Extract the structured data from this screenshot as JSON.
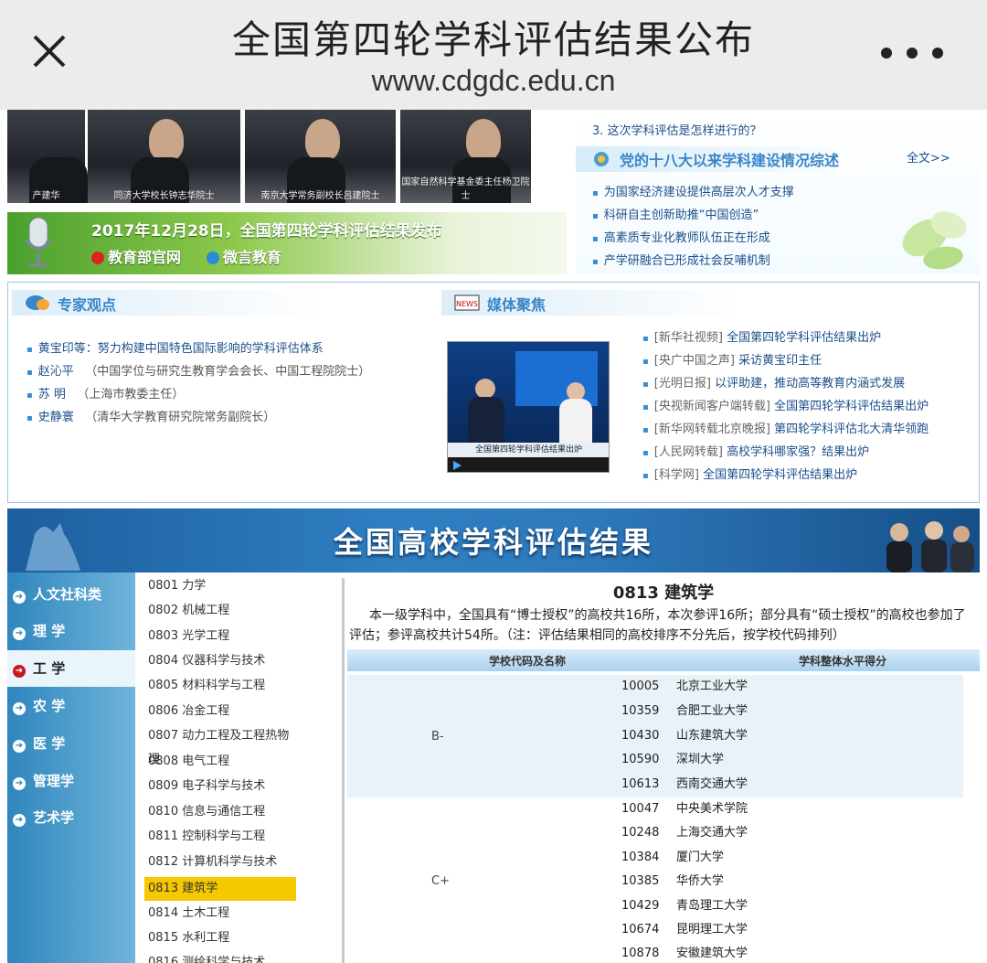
{
  "browser": {
    "title": "全国第四轮学科评估结果公布",
    "url": "www.cdgdc.edu.cn"
  },
  "banner": {
    "captions": [
      "产建华",
      "同济大学校长钟志华院士",
      "南京大学常务副校长吕建院士",
      "国家自然科学基金委主任杨卫院士"
    ],
    "announcement": "2017年12月28日，全国第四轮学科评估结果发布",
    "link1": "教育部官网",
    "link2": "微言教育"
  },
  "right_news": {
    "question3": "3. 这次学科评估是怎样进行的？",
    "section_title": "党的十八大以来学科建设情况综述",
    "full_text_link": "全文>>",
    "items": [
      "为国家经济建设提供高层次人才支撑",
      "科研自主创新助推“中国创造”",
      "高素质专业化教师队伍正在形成",
      "产学研融合已形成社会反哺机制"
    ]
  },
  "experts": {
    "title": "专家观点",
    "items": [
      {
        "name": "黄宝印等：努力构建中国特色国际影响的学科评估体系",
        "note": ""
      },
      {
        "name": "赵沁平",
        "note": "（中国学位与研究生教育学会会长、中国工程院院士）"
      },
      {
        "name": "苏  明",
        "note": "（上海市教委主任）"
      },
      {
        "name": "史静寰",
        "note": "（清华大学教育研究院常务副院长）"
      }
    ]
  },
  "media": {
    "title": "媒体聚焦",
    "icon_text": "NEWS",
    "video_caption": "全国第四轮学科评估结果出炉",
    "items": [
      {
        "src": "[新华社视频]",
        "text": "全国第四轮学科评估结果出炉"
      },
      {
        "src": "[央广中国之声]",
        "text": "采访黄宝印主任"
      },
      {
        "src": "[光明日报]",
        "text": "以评助建，推动高等教育内涵式发展"
      },
      {
        "src": "[央视新闻客户端转载]",
        "text": "全国第四轮学科评估结果出炉"
      },
      {
        "src": "[新华网转载北京晚报]",
        "text": "第四轮学科评估北大清华领跑"
      },
      {
        "src": "[人民网转载]",
        "text": "高校学科哪家强？结果出炉"
      },
      {
        "src": "[科学网]",
        "text": "全国第四轮学科评估结果出炉"
      }
    ]
  },
  "results": {
    "banner_title": "全国高校学科评估结果",
    "categories": [
      "人文社科类",
      "理 学",
      "工 学",
      "农 学",
      "医 学",
      "管理学",
      "艺术学"
    ],
    "active_category": "工 学",
    "subjects": [
      "0801 力学",
      "0802 机械工程",
      "0803 光学工程",
      "0804 仪器科学与技术",
      "0805 材料科学与工程",
      "0806 冶金工程",
      "0807 动力工程及工程热物理",
      "0808 电气工程",
      "0809 电子科学与技术",
      "0810 信息与通信工程",
      "0811 控制科学与工程",
      "0812 计算机科学与技术",
      "0813 建筑学",
      "0814 土木工程",
      "0815 水利工程",
      "0816 测绘科学与技术"
    ],
    "selected_subject": "0813 建筑学",
    "heading": "0813 建筑学",
    "description": "本一级学科中，全国具有“博士授权”的高校共16所，本次参评16所；部分具有“硕士授权”的高校也参加了评估；参评高校共计54所。（注：评估结果相同的高校排序不分先后，按学校代码排列）",
    "col_school": "学校代码及名称",
    "col_score": "学科整体水平得分",
    "groups": [
      {
        "grade": "B-",
        "rows": [
          {
            "code": "10005",
            "name": "北京工业大学"
          },
          {
            "code": "10359",
            "name": "合肥工业大学"
          },
          {
            "code": "10430",
            "name": "山东建筑大学"
          },
          {
            "code": "10590",
            "name": "深圳大学"
          },
          {
            "code": "10613",
            "name": "西南交通大学"
          }
        ]
      },
      {
        "grade": "C+",
        "rows": [
          {
            "code": "10047",
            "name": "中央美术学院"
          },
          {
            "code": "10248",
            "name": "上海交通大学"
          },
          {
            "code": "10384",
            "name": "厦门大学"
          },
          {
            "code": "10385",
            "name": "华侨大学"
          },
          {
            "code": "10429",
            "name": "青岛理工大学"
          },
          {
            "code": "10674",
            "name": "昆明理工大学"
          },
          {
            "code": "10878",
            "name": "安徽建筑大学"
          }
        ]
      }
    ]
  },
  "colors": {
    "link_blue": "#1b4f8a",
    "accent_blue": "#3a86c8",
    "nav_blue": "#2f86bd",
    "highlight_yellow": "#f5c800",
    "active_red": "#c8161d",
    "group_bg": "#e8f2f8"
  }
}
